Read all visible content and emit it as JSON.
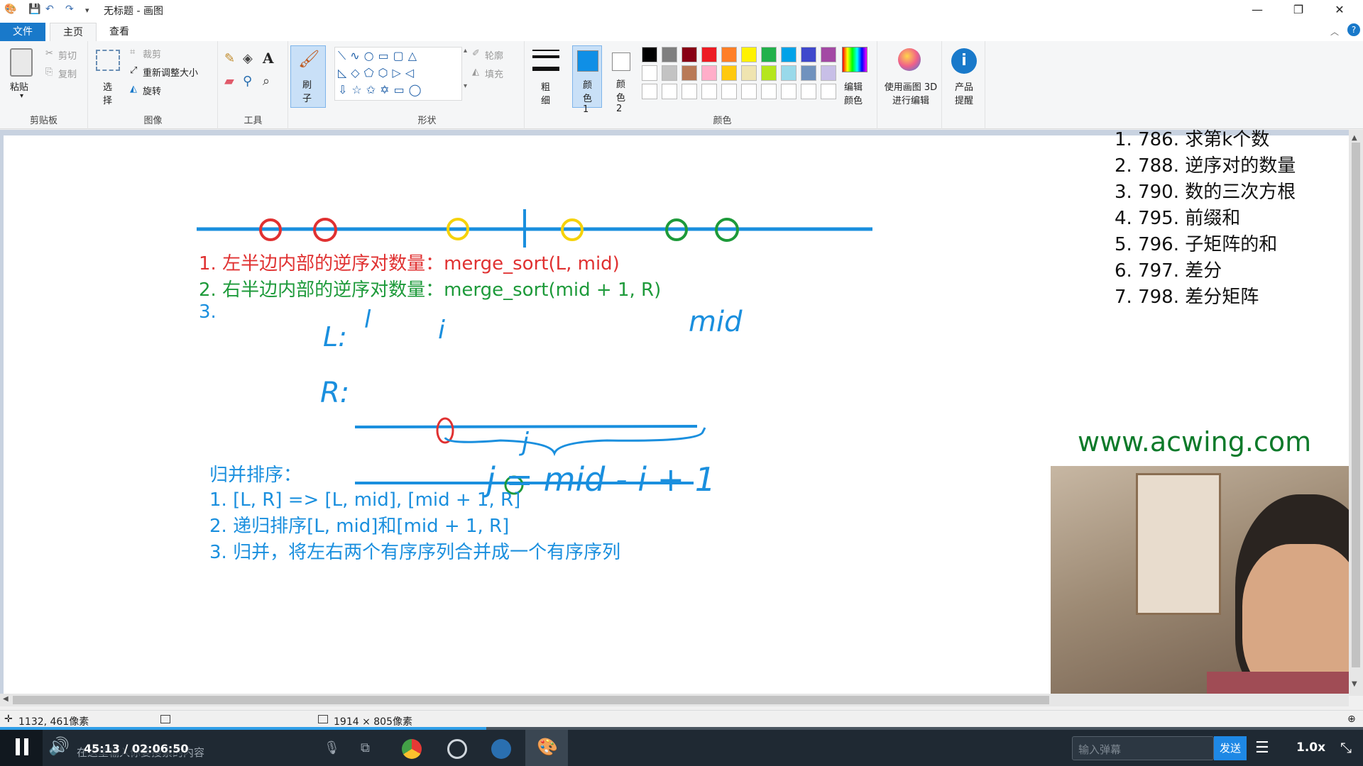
{
  "window": {
    "title": "无标题 - 画图",
    "controls": {
      "minimize": "—",
      "restore": "❐",
      "close": "✕"
    }
  },
  "tabs": [
    {
      "label": "文件"
    },
    {
      "label": "主页"
    },
    {
      "label": "查看"
    }
  ],
  "ribbon": {
    "clipboard": {
      "group": "剪贴板",
      "paste": "粘贴",
      "cut": "剪切",
      "copy": "复制"
    },
    "image": {
      "group": "图像",
      "select": "选择",
      "crop": "裁剪",
      "resize": "重新调整大小",
      "rotate": "旋转"
    },
    "tools": {
      "group": "工具"
    },
    "brushes": {
      "label": "刷子"
    },
    "shapes": {
      "group": "形状",
      "outline": "轮廓",
      "fill": "填充"
    },
    "size": {
      "label": "粗细"
    },
    "colors": {
      "group": "颜色",
      "color1": "颜色 1",
      "color2": "颜色 2",
      "edit": "编辑颜色",
      "color1_value": "#0f8fe6",
      "palette_row1": [
        "#000000",
        "#7f7f7f",
        "#880015",
        "#ed1c24",
        "#ff7f27",
        "#fff200",
        "#22b14c",
        "#00a2e8",
        "#3f48cc",
        "#a349a4"
      ],
      "palette_row2": [
        "#ffffff",
        "#c3c3c3",
        "#b97a57",
        "#ffaec9",
        "#ffc90e",
        "#efe4b0",
        "#b5e61d",
        "#99d9ea",
        "#7092be",
        "#c8bfe7"
      ]
    },
    "paint3d": {
      "label": "使用画图 3D 进行编辑"
    },
    "product": {
      "label": "产品提醒"
    }
  },
  "canvas": {
    "notes_red": "1. 左半边内部的逆序对数量：merge_sort(L, mid)",
    "notes_green": "2. 右半边内部的逆序对数量：merge_sort(mid + 1, R)",
    "notes_3": "3.",
    "hand_L": "L:",
    "hand_l": "l",
    "hand_i": "i",
    "hand_mid": "mid",
    "hand_R": "R:",
    "hand_j": "j",
    "hand_formula": "j = mid - i + 1",
    "merge_title": "归并排序：",
    "merge_items": [
      "1. [L, R] => [L, mid], [mid + 1, R]",
      "2. 递归排序[L, mid]和[mid + 1, R]",
      "3. 归并，将左右两个有序序列合并成一个有序序列"
    ],
    "problem_list": [
      "1. 786. 求第k个数",
      "2. 788. 逆序对的数量",
      "3. 790. 数的三次方根",
      "4. 795. 前缀和",
      "5. 796. 子矩阵的和",
      "6. 797. 差分",
      "7. 798. 差分矩阵"
    ],
    "watermark": "www.acwing.com"
  },
  "statusbar": {
    "cursor_pos": "1132, 461像素",
    "canvas_size": "1914 × 805像素"
  },
  "player": {
    "time": "45:13 / 02:06:50",
    "search_placeholder": "在这里输入你要搜索的内容",
    "danmaku_placeholder": "输入弹幕",
    "send": "发送",
    "speed": "1.0x",
    "progress": 0.357
  }
}
